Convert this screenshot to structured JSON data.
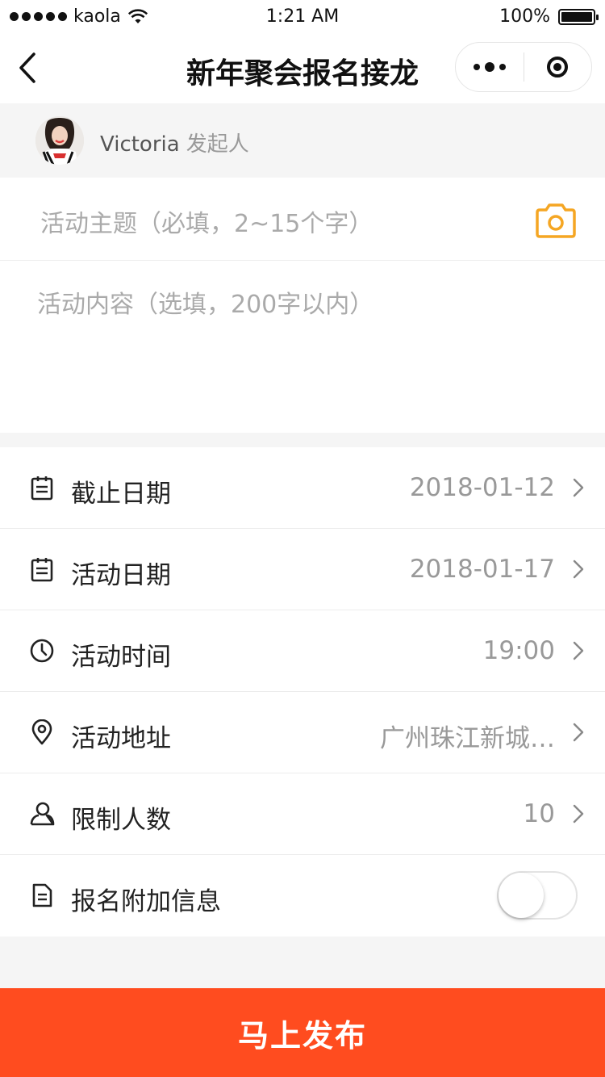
{
  "status_bar": {
    "carrier": "kaola",
    "time": "1:21 AM",
    "battery": "100%"
  },
  "nav": {
    "title": "新年聚会报名接龙",
    "back_icon": "chevron-left-icon",
    "more_icon": "more-dots-icon",
    "close_icon": "target-circle-icon"
  },
  "organizer": {
    "name": "Victoria",
    "role": "发起人"
  },
  "form": {
    "subject_placeholder": "活动主题（必填，2~15个字）",
    "content_placeholder": "活动内容（选填，200字以内）",
    "camera_icon": "camera-icon",
    "accent_color": "#f5a623"
  },
  "fields": [
    {
      "label": "截止日期",
      "value": "2018-01-12",
      "icon": "calendar-icon"
    },
    {
      "label": "活动日期",
      "value": "2018-01-17",
      "icon": "calendar-icon"
    },
    {
      "label": "活动时间",
      "value": "19:00",
      "icon": "clock-icon"
    },
    {
      "label": "活动地址",
      "value": "广州珠江新城…",
      "icon": "location-pin-icon"
    },
    {
      "label": "限制人数",
      "value": "10",
      "icon": "person-icon"
    },
    {
      "label": "报名附加信息",
      "toggle_on": false,
      "icon": "document-icon"
    }
  ],
  "publish": {
    "label": "马上发布",
    "color": "#ff4c1f"
  }
}
